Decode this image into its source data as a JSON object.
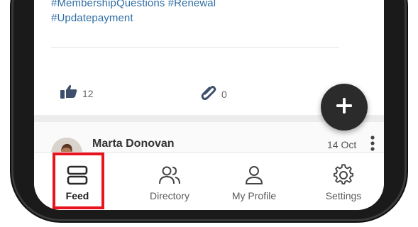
{
  "post": {
    "hashtags_line1": "#MembershipQuestions  #Renewal",
    "hashtags_line2": "#Updatepayment",
    "likes": "12",
    "attachments": "0"
  },
  "fab": {
    "icon": "plus-icon"
  },
  "next_post": {
    "author": "Marta Donovan",
    "date": "14 Oct"
  },
  "tabs": [
    {
      "label": "Feed",
      "icon": "feed-icon",
      "active": true
    },
    {
      "label": "Directory",
      "icon": "people-icon",
      "active": false
    },
    {
      "label": "My Profile",
      "icon": "person-icon",
      "active": false
    },
    {
      "label": "Settings",
      "icon": "gear-icon",
      "active": false
    }
  ],
  "colors": {
    "hashtag": "#2e6da4",
    "fab_bg": "#2b2b2b",
    "highlight": "#e8131f",
    "frame": "#1a1a1a"
  }
}
